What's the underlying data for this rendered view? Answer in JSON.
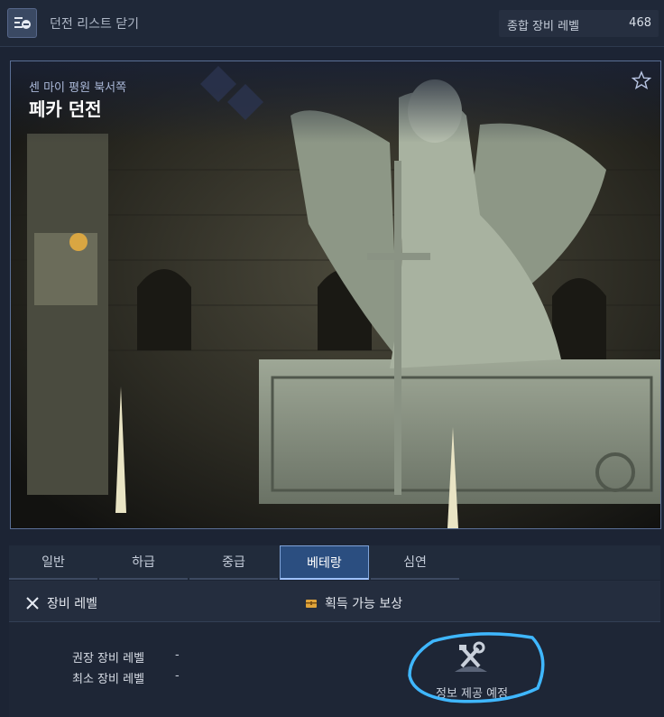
{
  "topbar": {
    "close_label": "던전 리스트 닫기",
    "gear_label": "종합 장비 레벨",
    "gear_value": "468"
  },
  "dungeon": {
    "region": "센 마이 평원 북서쪽",
    "name": "페카 던전"
  },
  "tabs": [
    {
      "label": "일반",
      "active": false
    },
    {
      "label": "하급",
      "active": false
    },
    {
      "label": "중급",
      "active": false
    },
    {
      "label": "베테랑",
      "active": true
    },
    {
      "label": "심연",
      "active": false
    }
  ],
  "panel": {
    "equip_header": "장비 레벨",
    "reward_header": "획득 가능 보상",
    "recommended_label": "권장 장비 레벨",
    "recommended_value": "-",
    "minimum_label": "최소 장비 레벨",
    "minimum_value": "-",
    "reward_text": "정보 제공 예정"
  },
  "colors": {
    "accent": "#2b4e80",
    "gold": "#e0a43a",
    "annotation": "#3fb7ff"
  }
}
